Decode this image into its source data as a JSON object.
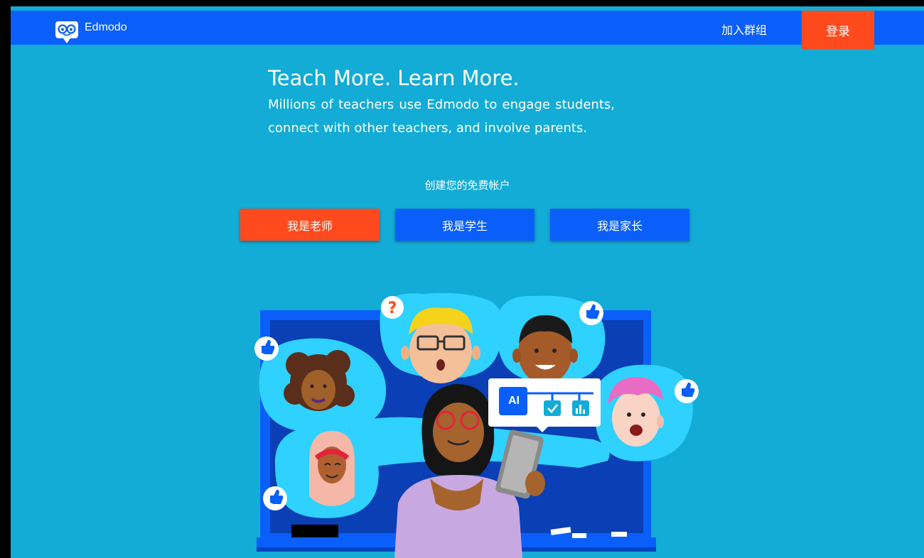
{
  "header": {
    "brand": "Edmodo",
    "join_group": "加入群组",
    "login": "登录"
  },
  "hero": {
    "title": "Teach More. Learn More.",
    "description": "Millions of teachers use Edmodo to engage students, connect with other teachers, and involve parents."
  },
  "signup": {
    "prompt": "创建您的免费帐户",
    "roles": [
      "我是老师",
      "我是学生",
      "我是家长"
    ]
  },
  "illustration": {
    "badge_text": "AI"
  },
  "colors": {
    "header_bg": "#0a5ffb",
    "page_bg": "#12acd6",
    "accent_orange": "#ff4a1d",
    "button_blue": "#0a5ffb"
  }
}
